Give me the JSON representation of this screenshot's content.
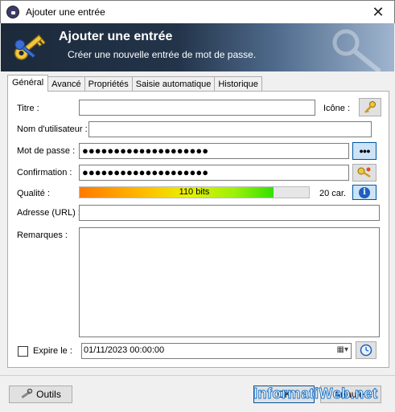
{
  "window": {
    "title": "Ajouter une entrée"
  },
  "banner": {
    "title": "Ajouter une entrée",
    "subtitle": "Créer une nouvelle entrée de mot de passe."
  },
  "tabs": [
    {
      "label": "Général",
      "active": true
    },
    {
      "label": "Avancé"
    },
    {
      "label": "Propriétés"
    },
    {
      "label": "Saisie automatique"
    },
    {
      "label": "Historique"
    }
  ],
  "form": {
    "title_label": "Titre :",
    "title_value": "",
    "icon_label": "Icône :",
    "username_label": "Nom d'utilisateur :",
    "username_value": "",
    "password_label": "Mot de passe :",
    "password_value": "●●●●●●●●●●●●●●●●●●●●",
    "confirm_label": "Confirmation :",
    "confirm_value": "●●●●●●●●●●●●●●●●●●●●",
    "toggle_mask_label": "●●●",
    "quality_label": "Qualité :",
    "quality_text": "110 bits",
    "quality_fraction": 0.847,
    "char_count": "20 car.",
    "url_label": "Adresse (URL) :",
    "url_value": "",
    "notes_label": "Remarques :",
    "notes_value": "",
    "expires_label": "Expire le :",
    "expires_checked": false,
    "expires_value": "01/11/2023 00:00:00"
  },
  "footer": {
    "tools_label": "Outils",
    "ok_label": "OK",
    "cancel_label": "Annuler"
  },
  "watermark": "InformatiWeb.net",
  "colors": {
    "banner_dark": "#1c2a3a",
    "accent_blue": "#005499",
    "quality_start": "#ff7a00",
    "quality_end": "#33e000"
  }
}
